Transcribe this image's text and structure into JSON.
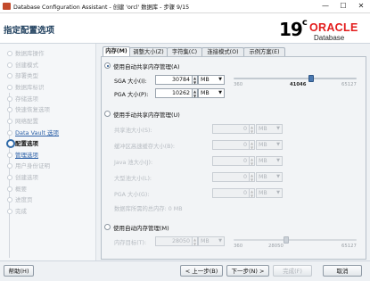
{
  "window": {
    "title": "Database Configuration Assistant - 创建 'orcl' 数据库 - 步骤 9/15",
    "minimize": "—",
    "maximize": "☐",
    "close": "✕"
  },
  "header": {
    "page_title": "指定配置选项",
    "logo_version": "19",
    "logo_version_sup": "c",
    "logo_brand": "ORACLE",
    "logo_product": "Database",
    "brand_color": "#e31c1c"
  },
  "sidebar": {
    "steps": [
      {
        "label": "数据库操作",
        "state": "done"
      },
      {
        "label": "创建模式",
        "state": "done"
      },
      {
        "label": "部署类型",
        "state": "done"
      },
      {
        "label": "数据库标识",
        "state": "done"
      },
      {
        "label": "存储选项",
        "state": "done"
      },
      {
        "label": "快速恢复选项",
        "state": "done"
      },
      {
        "label": "网络配置",
        "state": "done"
      },
      {
        "label": "Data Vault 选项",
        "state": "link"
      },
      {
        "label": "配置选项",
        "state": "current"
      },
      {
        "label": "管理选项",
        "state": "link"
      },
      {
        "label": "用户身份证明",
        "state": "future"
      },
      {
        "label": "创建选项",
        "state": "future"
      },
      {
        "label": "概要",
        "state": "future"
      },
      {
        "label": "进度页",
        "state": "future"
      },
      {
        "label": "完成",
        "state": "future"
      }
    ]
  },
  "tabs": [
    "内存(M)",
    "调整大小(Z)",
    "字符集(C)",
    "连接模式(O)",
    "示例方案(E)"
  ],
  "memory": {
    "auto_shared": {
      "label": "使用自动共享内存管理(A)",
      "sga_label": "SGA 大小(I):",
      "sga_value": "30784",
      "sga_unit": "MB",
      "pga_label": "PGA 大小(P):",
      "pga_value": "10262",
      "pga_unit": "MB",
      "slider_min": "360",
      "slider_current": "41046",
      "slider_max": "65127",
      "slider_fraction": 0.63
    },
    "manual_shared": {
      "label": "使用手动共享内存管理(U)",
      "fields": [
        {
          "label": "共享池大小(S):",
          "value": "0",
          "unit": "MB"
        },
        {
          "label": "缓冲区高速缓存大小(B):",
          "value": "0",
          "unit": "MB"
        },
        {
          "label": "Java 池大小(J):",
          "value": "0",
          "unit": "MB"
        },
        {
          "label": "大型池大小(L):",
          "value": "0",
          "unit": "MB"
        },
        {
          "label": "PGA 大小(G):",
          "value": "0",
          "unit": "MB"
        }
      ],
      "total_text": "数据库所需的总内存: 0 MB"
    },
    "auto": {
      "label": "使用自动内存管理(M)",
      "target_label": "内存目标(T):",
      "target_value": "28050",
      "target_unit": "MB",
      "slider_min": "360",
      "slider_current": "28050",
      "slider_max": "65127",
      "slider_fraction": 0.43
    }
  },
  "buttons": {
    "help": "帮助(H)",
    "back": "< 上一步(B)",
    "next": "下一步(N) >",
    "finish": "完成(F)",
    "cancel": "取消"
  }
}
